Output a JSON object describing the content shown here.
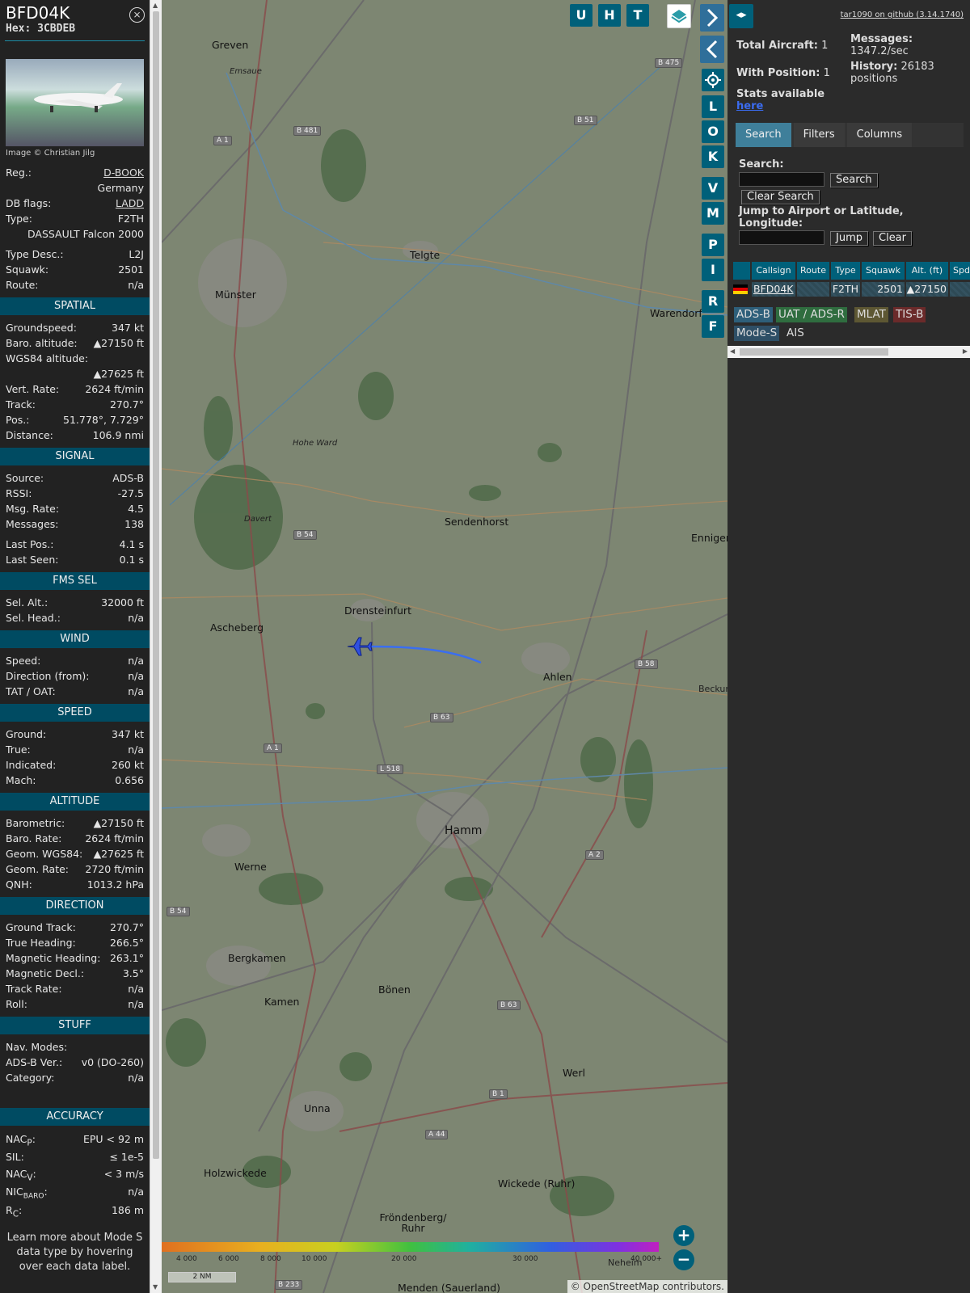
{
  "panel": {
    "callsign": "BFD04K",
    "hex_label": "Hex:",
    "hex": "3CBDEB",
    "close_glyph": "⨯",
    "photo_credit": "Image © Christian Jilg",
    "reg_label": "Reg.:",
    "reg": "D-BOOK",
    "country": "Germany",
    "dbflags_label": "DB flags:",
    "dbflags": "LADD",
    "type_label": "Type:",
    "type": "F2TH",
    "type_name": "DASSAULT Falcon 2000",
    "typedesc_label": "Type Desc.:",
    "typedesc": "L2J",
    "squawk_label": "Squawk:",
    "squawk": "2501",
    "route_label": "Route:",
    "route": "n/a"
  },
  "spatial": {
    "title": "SPATIAL",
    "groundspeed_label": "Groundspeed:",
    "groundspeed": "347 kt",
    "baro_label": "Baro. altitude:",
    "baro": "▲27150 ft",
    "wgs_label": "WGS84 altitude:",
    "wgs": "▲27625 ft",
    "vrate_label": "Vert. Rate:",
    "vrate": "2624 ft/min",
    "track_label": "Track:",
    "track": "270.7°",
    "pos_label": "Pos.:",
    "pos": "51.778°, 7.729°",
    "distance_label": "Distance:",
    "distance": "106.9 nmi"
  },
  "signal": {
    "title": "SIGNAL",
    "source_label": "Source:",
    "source": "ADS-B",
    "rssi_label": "RSSI:",
    "rssi": "-27.5",
    "msgrate_label": "Msg. Rate:",
    "msgrate": "4.5",
    "messages_label": "Messages:",
    "messages": "138",
    "lastpos_label": "Last Pos.:",
    "lastpos": "4.1 s",
    "lastseen_label": "Last Seen:",
    "lastseen": "0.1 s"
  },
  "fms": {
    "title": "FMS SEL",
    "selalt_label": "Sel. Alt.:",
    "selalt": "32000 ft",
    "selhead_label": "Sel. Head.:",
    "selhead": "n/a"
  },
  "wind": {
    "title": "WIND",
    "speed_label": "Speed:",
    "speed": "n/a",
    "dir_label": "Direction (from):",
    "dir": "n/a",
    "tat_label": "TAT / OAT:",
    "tat": "n/a"
  },
  "speed": {
    "title": "SPEED",
    "ground_label": "Ground:",
    "ground": "347 kt",
    "true_label": "True:",
    "true": "n/a",
    "ind_label": "Indicated:",
    "ind": "260 kt",
    "mach_label": "Mach:",
    "mach": "0.656"
  },
  "altitude": {
    "title": "ALTITUDE",
    "baro_label": "Barometric:",
    "baro": "▲27150 ft",
    "barorate_label": "Baro. Rate:",
    "barorate": "2624 ft/min",
    "geom_label": "Geom. WGS84:",
    "geom": "▲27625 ft",
    "geomrate_label": "Geom. Rate:",
    "geomrate": "2720 ft/min",
    "qnh_label": "QNH:",
    "qnh": "1013.2 hPa"
  },
  "direction": {
    "title": "DIRECTION",
    "gtrack_label": "Ground Track:",
    "gtrack": "270.7°",
    "thead_label": "True Heading:",
    "thead": "266.5°",
    "mhead_label": "Magnetic Heading:",
    "mhead": "263.1°",
    "mdecl_label": "Magnetic Decl.:",
    "mdecl": "3.5°",
    "trate_label": "Track Rate:",
    "trate": "n/a",
    "roll_label": "Roll:",
    "roll": "n/a"
  },
  "stuff": {
    "title": "STUFF",
    "navmodes_label": "Nav. Modes:",
    "navmodes": "",
    "adsbver_label": "ADS-B Ver.:",
    "adsbver": "v0 (DO-260)",
    "category_label": "Category:",
    "category": "n/a"
  },
  "accuracy": {
    "title": "ACCURACY",
    "nacp_main": "NAC",
    "nacp_sub": "P",
    "nacp": "EPU < 92 m",
    "sil_label": "SIL:",
    "sil": "≤ 1e-5",
    "nacv_main": "NAC",
    "nacv_sub": "V",
    "nacv": "< 3 m/s",
    "nicbaro_main": "NIC",
    "nicbaro_sub": "BARO",
    "nicbaro": "n/a",
    "rc_main": "R",
    "rc_sub": "C",
    "rc": "186 m"
  },
  "footer_note": "Learn more about Mode S data type by hovering over each data label.",
  "map": {
    "buttons_top": [
      "U",
      "H",
      "T"
    ],
    "buttons_side": [
      "L",
      "O",
      "K",
      "V",
      "M",
      "P",
      "I",
      "R",
      "F"
    ],
    "cities": [
      "Greven",
      "Münster",
      "Telgte",
      "Warendorf",
      "Sendenhorst",
      "Ennigerloh",
      "Drensteinfurt",
      "Ascheberg",
      "Ahlen",
      "Hamm",
      "Werne",
      "Bergkamen",
      "Kamen",
      "Bönen",
      "Werl",
      "Unna",
      "Holzwickede",
      "Wickede (Ruhr)",
      "Fröndenberg/ Ruhr",
      "Menden (Sauerland)",
      "Hohe Ward",
      "Davert",
      "Emsaue",
      "Beckum",
      "Neheim"
    ],
    "shields": [
      "B 475",
      "B 481",
      "A 1",
      "B 51",
      "B 54",
      "B 58",
      "B 63",
      "L 518",
      "A 1",
      "A 2",
      "B 54",
      "B 63",
      "B 1",
      "A 44",
      "B 233"
    ],
    "colorbar_labels": [
      "4 000",
      "6 000",
      "8 000",
      "10 000",
      "20 000",
      "30 000",
      "40 000+"
    ],
    "scale": "2 NM",
    "attribution": "© OpenStreetMap contributors."
  },
  "sidebar": {
    "github": "tar1090 on github (3.14.1740)",
    "total_label": "Total Aircraft:",
    "total": "1",
    "withpos_label": "With Position:",
    "withpos": "1",
    "stats_label": "Stats available",
    "stats_link": "here",
    "messages_label": "Messages:",
    "messages": "1347.2/sec",
    "history_label": "History:",
    "history": "26183 positions",
    "tabs": [
      "Search",
      "Filters",
      "Columns"
    ],
    "search_label": "Search:",
    "search_button": "Search",
    "clear_search_button": "Clear Search",
    "jump_label": "Jump to Airport or Latitude, Longitude:",
    "jump_button": "Jump",
    "clear_button": "Clear",
    "columns": [
      "Callsign",
      "Route",
      "Type",
      "Squawk",
      "Alt. (ft)",
      "Spd"
    ],
    "row": {
      "callsign": "BFD04K",
      "route": "",
      "type": "F2TH",
      "squawk": "2501",
      "alt": "▲27150"
    },
    "sources": [
      "ADS-B",
      "UAT / ADS-R",
      "MLAT",
      "TIS-B",
      "Mode-S",
      "AIS"
    ]
  },
  "colors": {
    "accent": "#00607a",
    "section": "#004b62",
    "track": "#3a6ef0",
    "aircraft": "#3050e0"
  }
}
